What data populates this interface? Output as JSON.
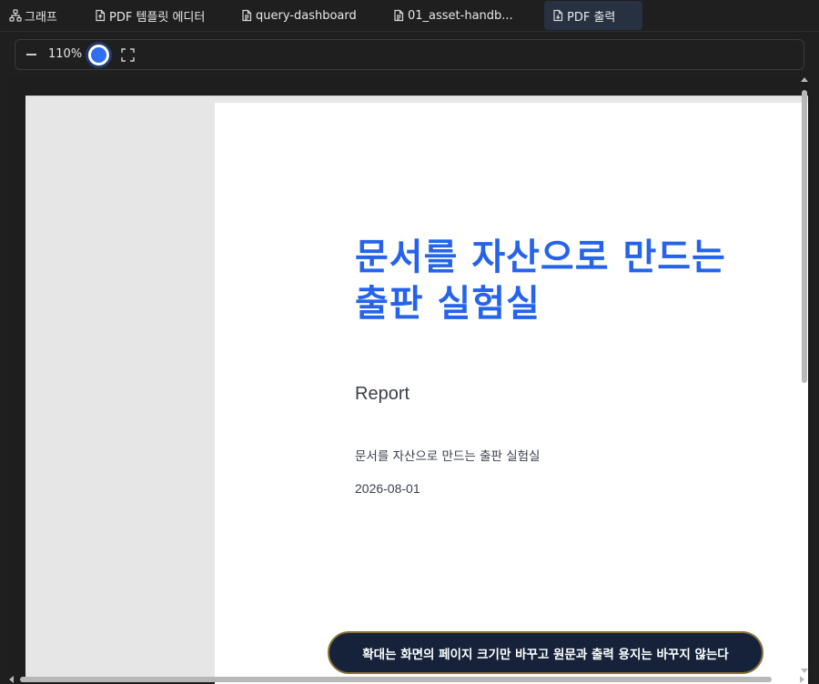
{
  "tabs": [
    {
      "label": "그래프",
      "icon": "graph-icon"
    },
    {
      "label": "PDF 템플릿 에디터",
      "icon": "file-template-icon"
    },
    {
      "label": "query-dashboard",
      "icon": "document-icon"
    },
    {
      "label": "01_asset-handb...",
      "icon": "document-icon"
    },
    {
      "label": "PDF 출력",
      "icon": "file-download-icon",
      "active": true
    }
  ],
  "toolbar": {
    "zoom_level": "110%",
    "zoom_fraction": 0.5
  },
  "document": {
    "title_line1": "문서를 자산으로 만드는",
    "title_line2": "출판 실험실",
    "report_label": "Report",
    "subtitle": "문서를 자산으로 만드는 출판 실험실",
    "date": "2026-08-01"
  },
  "toast": {
    "message": "확대는 화면의 페이지 크기만 바꾸고 원문과 출력 용지는 바꾸지 않는다"
  },
  "colors": {
    "accent": "#2563eb",
    "active_tab": "#283142",
    "toast_bg": "#15223a",
    "toast_border": "#8a6f36"
  }
}
